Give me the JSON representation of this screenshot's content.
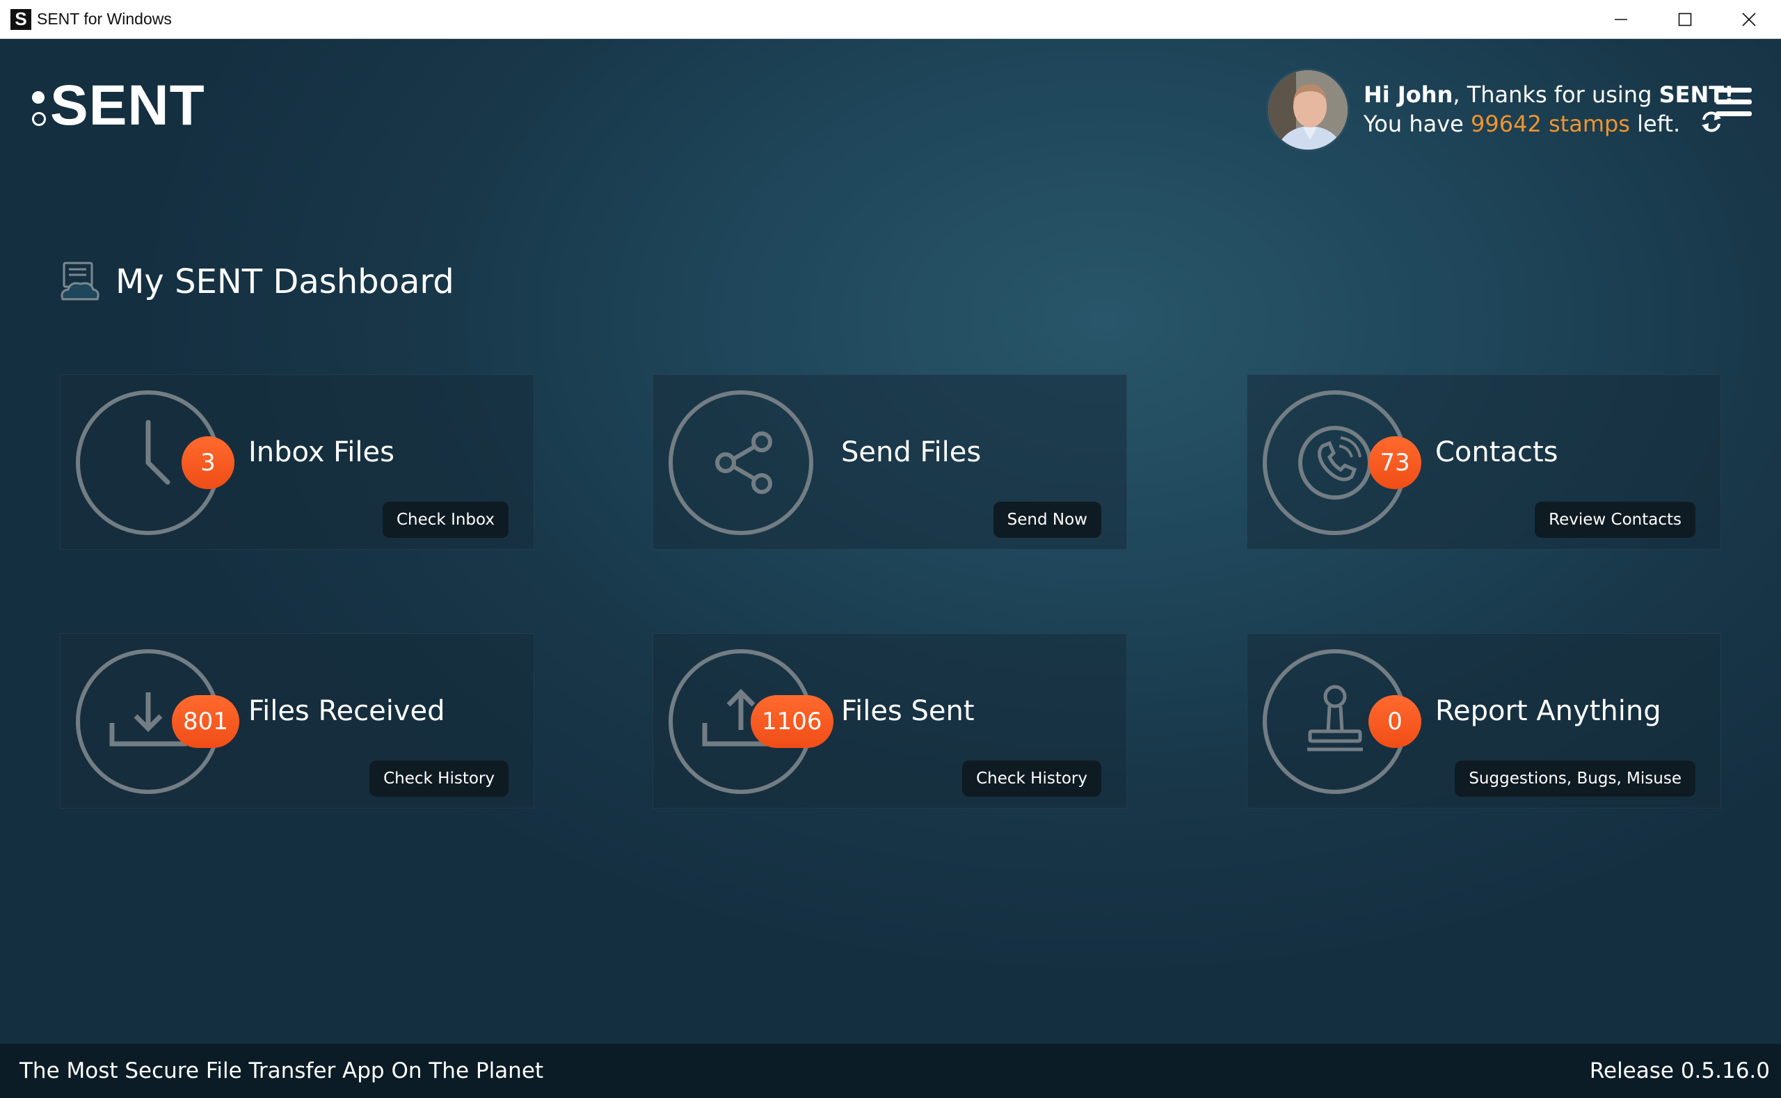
{
  "window": {
    "app_icon_letter": "S",
    "title": "SENT for Windows"
  },
  "header": {
    "logo_text": "SENT",
    "greeting_name": "Hi John",
    "greeting_rest": ", Thanks for using ",
    "greeting_brand": "SENT!",
    "stamps_prefix": "You have ",
    "stamps_value": "99642 stamps",
    "stamps_suffix": " left."
  },
  "dashboard": {
    "title": "My SENT Dashboard",
    "cards": [
      {
        "title": "Inbox Files",
        "badge": "3",
        "button": "Check Inbox",
        "icon": "clock-icon"
      },
      {
        "title": "Send Files",
        "badge": "",
        "button": "Send Now",
        "icon": "share-icon"
      },
      {
        "title": "Contacts",
        "badge": "73",
        "button": "Review Contacts",
        "icon": "phone-icon"
      },
      {
        "title": "Files Received",
        "badge": "801",
        "button": "Check History",
        "icon": "download-icon"
      },
      {
        "title": "Files Sent",
        "badge": "1106",
        "button": "Check History",
        "icon": "upload-icon"
      },
      {
        "title": "Report Anything",
        "badge": "0",
        "button": "Suggestions, Bugs, Misuse",
        "icon": "stamp-icon"
      }
    ]
  },
  "footer": {
    "tagline": "The Most Secure File Transfer App On The Planet",
    "release": "Release 0.5.16.0"
  },
  "colors": {
    "accent_orange": "#f0942f",
    "badge_orange": "#f04d17",
    "background": "#1f465a",
    "footer_bg": "#0b1c26"
  }
}
